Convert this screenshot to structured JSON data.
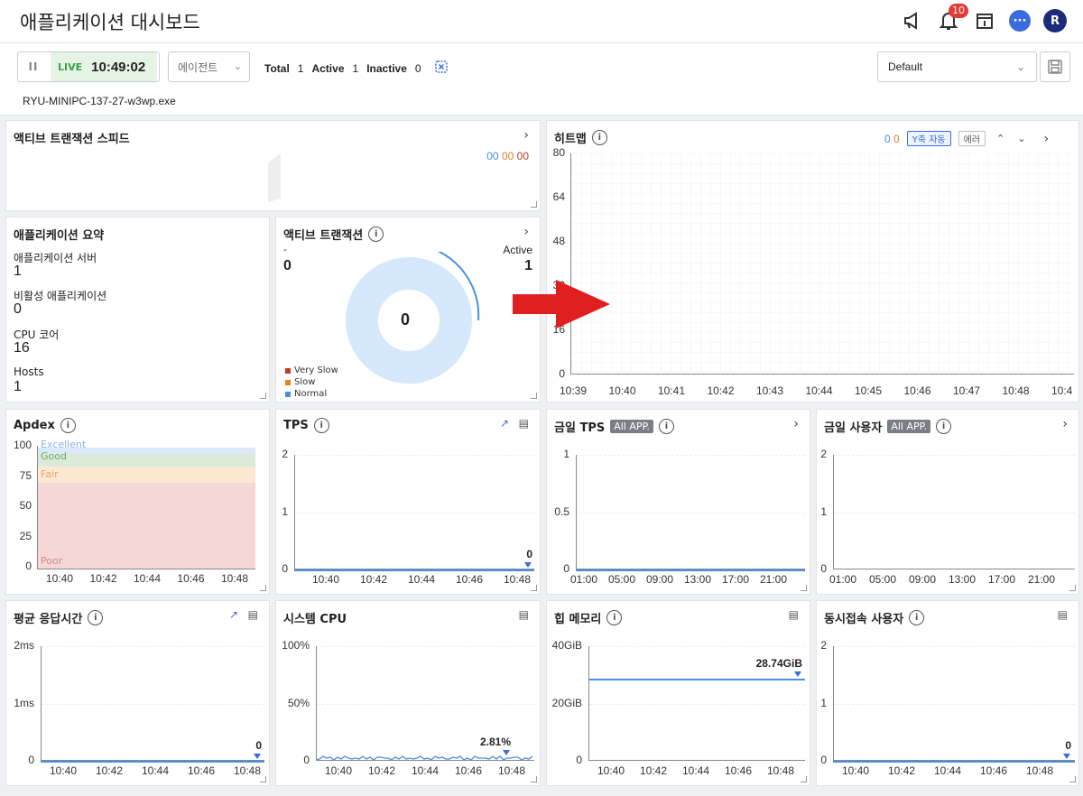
{
  "header": {
    "title": "애플리케이션 대시보드",
    "notif_count": "10",
    "avatar": "R",
    "chat": "···"
  },
  "toolbar": {
    "pause": "II",
    "live": "LIVE",
    "time": "10:49:02",
    "agent_label": "에이전트",
    "total_label": "Total",
    "total": "1",
    "active_label": "Active",
    "active": "1",
    "inactive_label": "Inactive",
    "inactive": "0",
    "layout_select": "Default",
    "exe": "RYU-MINIPC-137-27-w3wp.exe"
  },
  "speed": {
    "title": "액티브 트랜잭션 스피드",
    "counts": [
      "00",
      "00",
      "00"
    ]
  },
  "heatmap": {
    "title": "히트맵",
    "count_a": "0",
    "count_b": "0",
    "y_auto": "Y축 자동",
    "error": "에러",
    "y_ticks": [
      "80",
      "64",
      "48",
      "32",
      "16",
      "0"
    ],
    "x_ticks": [
      "10:39",
      "10:40",
      "10:41",
      "10:42",
      "10:43",
      "10:44",
      "10:45",
      "10:46",
      "10:47",
      "10:48",
      "10:4"
    ]
  },
  "summary": {
    "title": "애플리케이션 요약",
    "items": [
      {
        "label": "애플리케이션 서버",
        "value": "1"
      },
      {
        "label": "비활성 애플리케이션",
        "value": "0"
      },
      {
        "label": "CPU 코어",
        "value": "16"
      },
      {
        "label": "Hosts",
        "value": "1"
      }
    ]
  },
  "active_tx": {
    "title": "액티브 트랜잭션",
    "left_label": "-",
    "left_value": "0",
    "right_label": "Active",
    "right_value": "1",
    "center": "0",
    "legend": [
      {
        "label": "Very Slow",
        "color": "#c0392b"
      },
      {
        "label": "Slow",
        "color": "#e67e22"
      },
      {
        "label": "Normal",
        "color": "#4a90e2"
      }
    ]
  },
  "apdex": {
    "title": "Apdex",
    "bands": [
      "Excellent",
      "Good",
      "Fair",
      "Poor"
    ],
    "y_ticks": [
      "100",
      "75",
      "50",
      "25",
      "0"
    ],
    "x_ticks": [
      "10:40",
      "10:42",
      "10:44",
      "10:46",
      "10:48"
    ]
  },
  "tps": {
    "title": "TPS",
    "y_ticks": [
      "2",
      "1",
      "0"
    ],
    "x_ticks": [
      "10:40",
      "10:42",
      "10:44",
      "10:46",
      "10:48"
    ],
    "last": "0"
  },
  "today_tps": {
    "title": "금일 TPS",
    "tag": "All APP.",
    "y_ticks": [
      "1",
      "0.5",
      "0"
    ],
    "x_ticks": [
      "01:00",
      "05:00",
      "09:00",
      "13:00",
      "17:00",
      "21:00"
    ]
  },
  "today_users": {
    "title": "금일 사용자",
    "tag": "All APP.",
    "y_ticks": [
      "2",
      "1",
      "0"
    ],
    "x_ticks": [
      "01:00",
      "05:00",
      "09:00",
      "13:00",
      "17:00",
      "21:00"
    ]
  },
  "resp": {
    "title": "평균 응답시간",
    "y_ticks": [
      "2ms",
      "1ms",
      "0"
    ],
    "x_ticks": [
      "10:40",
      "10:42",
      "10:44",
      "10:46",
      "10:48"
    ],
    "last": "0"
  },
  "cpu": {
    "title": "시스템 CPU",
    "y_ticks": [
      "100%",
      "50%",
      "0"
    ],
    "x_ticks": [
      "10:40",
      "10:42",
      "10:44",
      "10:46",
      "10:48"
    ],
    "last": "2.81%"
  },
  "heap": {
    "title": "힙 메모리",
    "y_ticks": [
      "40GiB",
      "20GiB",
      "0"
    ],
    "x_ticks": [
      "10:40",
      "10:42",
      "10:44",
      "10:46",
      "10:48"
    ],
    "last": "28.74GiB"
  },
  "concurrent": {
    "title": "동시접속 사용자",
    "y_ticks": [
      "2",
      "1",
      "0"
    ],
    "x_ticks": [
      "10:40",
      "10:42",
      "10:44",
      "10:46",
      "10:48"
    ],
    "last": "0"
  },
  "colors": {
    "accent": "#3b6be0",
    "line": "#4a90e2",
    "live": "#3aa14a",
    "arrow": "#e02020"
  },
  "chart_data": [
    {
      "type": "line",
      "title": "TPS",
      "x": [
        "10:40",
        "10:42",
        "10:44",
        "10:46",
        "10:48"
      ],
      "series": [
        {
          "values": [
            0,
            0,
            0,
            0,
            0
          ]
        }
      ],
      "ylim": [
        0,
        2
      ]
    },
    {
      "type": "line",
      "title": "힙 메모리",
      "x": [
        "10:40",
        "10:42",
        "10:44",
        "10:46",
        "10:48"
      ],
      "series": [
        {
          "values": [
            28.74,
            28.74,
            28.74,
            28.74,
            28.74
          ]
        }
      ],
      "ylim": [
        0,
        40
      ]
    },
    {
      "type": "line",
      "title": "시스템 CPU",
      "x": [
        "10:40",
        "10:42",
        "10:44",
        "10:46",
        "10:48"
      ],
      "series": [
        {
          "values": [
            1,
            2,
            1,
            2,
            2.81
          ]
        }
      ],
      "ylim": [
        0,
        100
      ]
    }
  ]
}
